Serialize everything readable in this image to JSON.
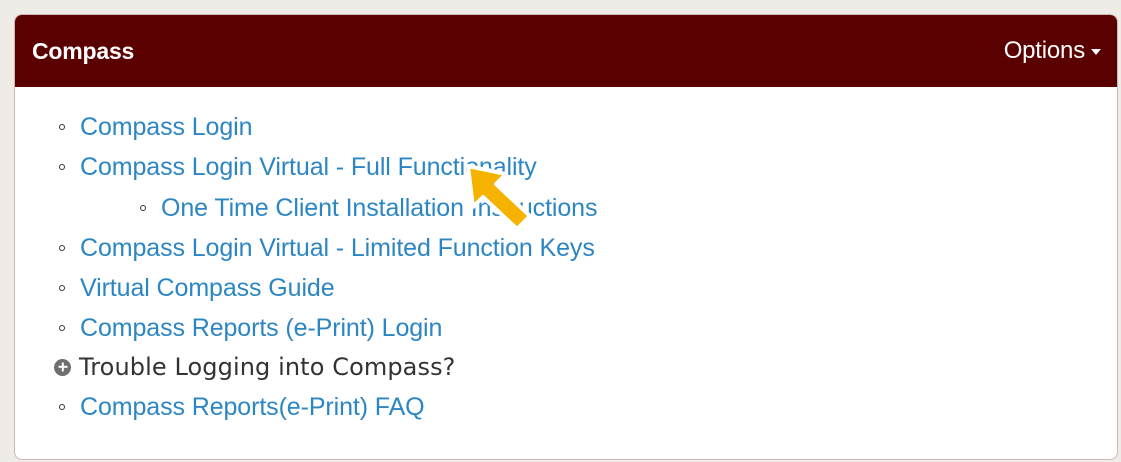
{
  "header": {
    "title": "Compass",
    "options_label": "Options"
  },
  "links": [
    {
      "label": "Compass Login"
    },
    {
      "label": "Compass Login Virtual - Full Functionality"
    },
    {
      "label": "One Time Client Installation Instructions"
    },
    {
      "label": "Compass Login Virtual - Limited Function Keys"
    },
    {
      "label": "Virtual Compass Guide"
    },
    {
      "label": "Compass Reports (e-Print) Login"
    },
    {
      "label": "Trouble Logging into Compass?"
    },
    {
      "label": "Compass Reports(e-Print) FAQ"
    }
  ],
  "colors": {
    "header_bg": "#5b0000",
    "link": "#2c86c4",
    "pointer_arrow": "#f5b300"
  }
}
